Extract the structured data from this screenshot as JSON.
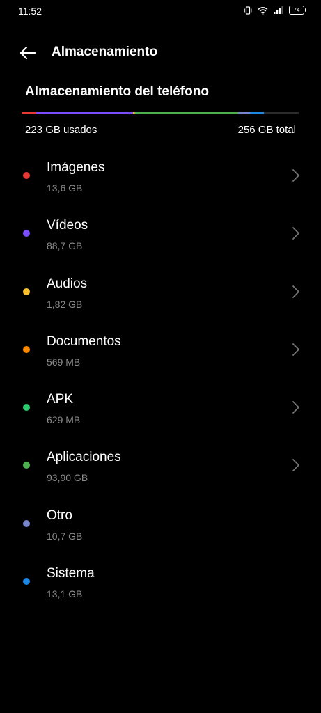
{
  "status_bar": {
    "time": "11:52",
    "battery": "74",
    "icons": [
      "vibrate-icon",
      "wifi-icon",
      "signal-icon",
      "battery-icon"
    ]
  },
  "header": {
    "title": "Almacenamiento"
  },
  "storage": {
    "section_title": "Almacenamiento del teléfono",
    "used_label": "223 GB usados",
    "total_label": "256 GB total",
    "bar_segments": [
      {
        "color": "#e53935",
        "fraction": 0.053
      },
      {
        "color": "#7c4dff",
        "fraction": 0.347
      },
      {
        "color": "#fbc02d",
        "fraction": 0.007
      },
      {
        "color": "#fb8c00",
        "fraction": 0.002
      },
      {
        "color": "#2ecc71",
        "fraction": 0.003
      },
      {
        "color": "#4caf50",
        "fraction": 0.367
      },
      {
        "color": "#7986cb",
        "fraction": 0.042
      },
      {
        "color": "#1e88e5",
        "fraction": 0.051
      }
    ]
  },
  "categories": [
    {
      "name": "Imágenes",
      "size": "13,6 GB",
      "color": "#e53935",
      "chevron": true
    },
    {
      "name": "Vídeos",
      "size": "88,7 GB",
      "color": "#7c4dff",
      "chevron": true
    },
    {
      "name": "Audios",
      "size": "1,82 GB",
      "color": "#fbc02d",
      "chevron": true
    },
    {
      "name": "Documentos",
      "size": "569 MB",
      "color": "#fb8c00",
      "chevron": true
    },
    {
      "name": "APK",
      "size": "629 MB",
      "color": "#2ecc71",
      "chevron": true
    },
    {
      "name": "Aplicaciones",
      "size": "93,90  GB",
      "color": "#4caf50",
      "chevron": true
    },
    {
      "name": "Otro",
      "size": "10,7 GB",
      "color": "#7986cb",
      "chevron": false
    },
    {
      "name": "Sistema",
      "size": "13,1 GB",
      "color": "#1e88e5",
      "chevron": false
    }
  ]
}
